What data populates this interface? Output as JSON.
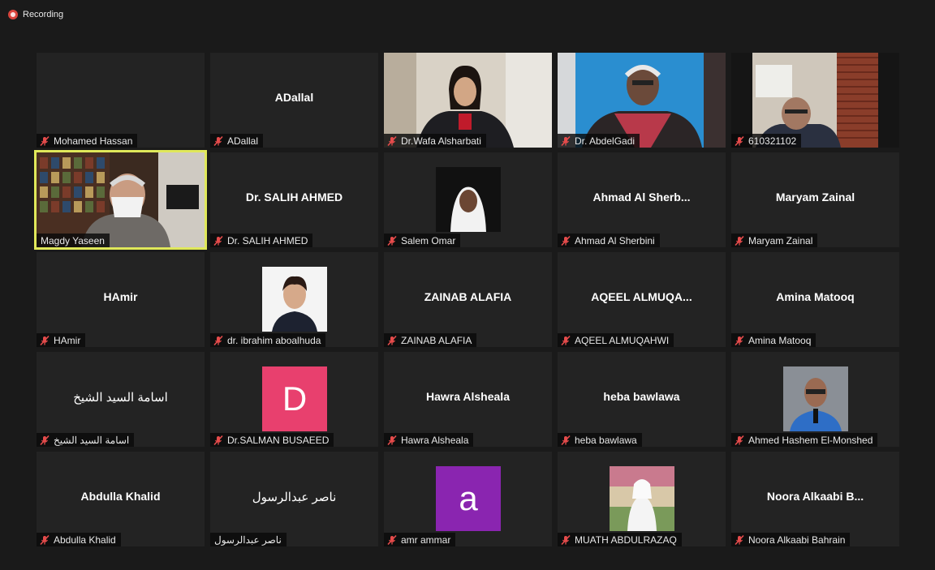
{
  "recording": {
    "label": "Recording"
  },
  "colors": {
    "active_border": "#e0e85a",
    "tile_bg": "#232323",
    "muted_mic": "#e54b4b"
  },
  "participants": [
    {
      "label": "Mohamed Hassan",
      "muted": true,
      "kind": "blank"
    },
    {
      "display": "ADallal",
      "label": "ADallal",
      "muted": true,
      "kind": "name"
    },
    {
      "label": "Dr.Wafa Alsharbati",
      "muted": true,
      "kind": "video"
    },
    {
      "label": "Dr. AbdelGadi",
      "muted": true,
      "kind": "video"
    },
    {
      "label": "610321102",
      "muted": true,
      "kind": "video"
    },
    {
      "label": "Magdy Yaseen",
      "muted": false,
      "kind": "video",
      "active": true
    },
    {
      "display": "Dr. SALIH AHMED",
      "label": "Dr. SALIH AHMED",
      "muted": true,
      "kind": "name"
    },
    {
      "label": "Salem Omar",
      "muted": true,
      "kind": "photo"
    },
    {
      "display": "Ahmad Al Sherb...",
      "label": "Ahmad Al Sherbini",
      "muted": true,
      "kind": "name"
    },
    {
      "display": "Maryam Zainal",
      "label": "Maryam Zainal",
      "muted": true,
      "kind": "name"
    },
    {
      "display": "HAmir",
      "label": "HAmir",
      "muted": true,
      "kind": "name"
    },
    {
      "label": "dr. ibrahim aboalhuda",
      "muted": true,
      "kind": "photo"
    },
    {
      "display": "ZAINAB ALAFIA",
      "label": "ZAINAB ALAFIA",
      "muted": true,
      "kind": "name"
    },
    {
      "display": "AQEEL ALMUQA...",
      "label": "AQEEL ALMUQAHWI",
      "muted": true,
      "kind": "name"
    },
    {
      "display": "Amina Matooq",
      "label": "Amina Matooq",
      "muted": true,
      "kind": "name"
    },
    {
      "display": "اسامة السيد الشيخ",
      "label": "اسامة السيد الشيخ",
      "muted": true,
      "kind": "name",
      "rtl": true
    },
    {
      "label": "Dr.SALMAN BUSAEED",
      "muted": true,
      "kind": "letter",
      "letter": "D",
      "color": "#e8406e"
    },
    {
      "display": "Hawra Alsheala",
      "label": "Hawra Alsheala",
      "muted": true,
      "kind": "name"
    },
    {
      "display": "heba bawlawa",
      "label": "heba bawlawa",
      "muted": true,
      "kind": "name"
    },
    {
      "label": "Ahmed Hashem El-Monshed",
      "muted": true,
      "kind": "photo"
    },
    {
      "display": "Abdulla Khalid",
      "label": "Abdulla Khalid",
      "muted": true,
      "kind": "name"
    },
    {
      "display": "ناصر عبدالرسول",
      "label": "ناصر عبدالرسول",
      "muted": false,
      "kind": "name",
      "rtl": true
    },
    {
      "label": "amr ammar",
      "muted": true,
      "kind": "letter",
      "letter": "a",
      "color": "#8a25b0"
    },
    {
      "label": "MUATH ABDULRAZAQ",
      "muted": true,
      "kind": "photo"
    },
    {
      "display": "Noora Alkaabi B...",
      "label": "Noora Alkaabi Bahrain",
      "muted": true,
      "kind": "name"
    }
  ]
}
